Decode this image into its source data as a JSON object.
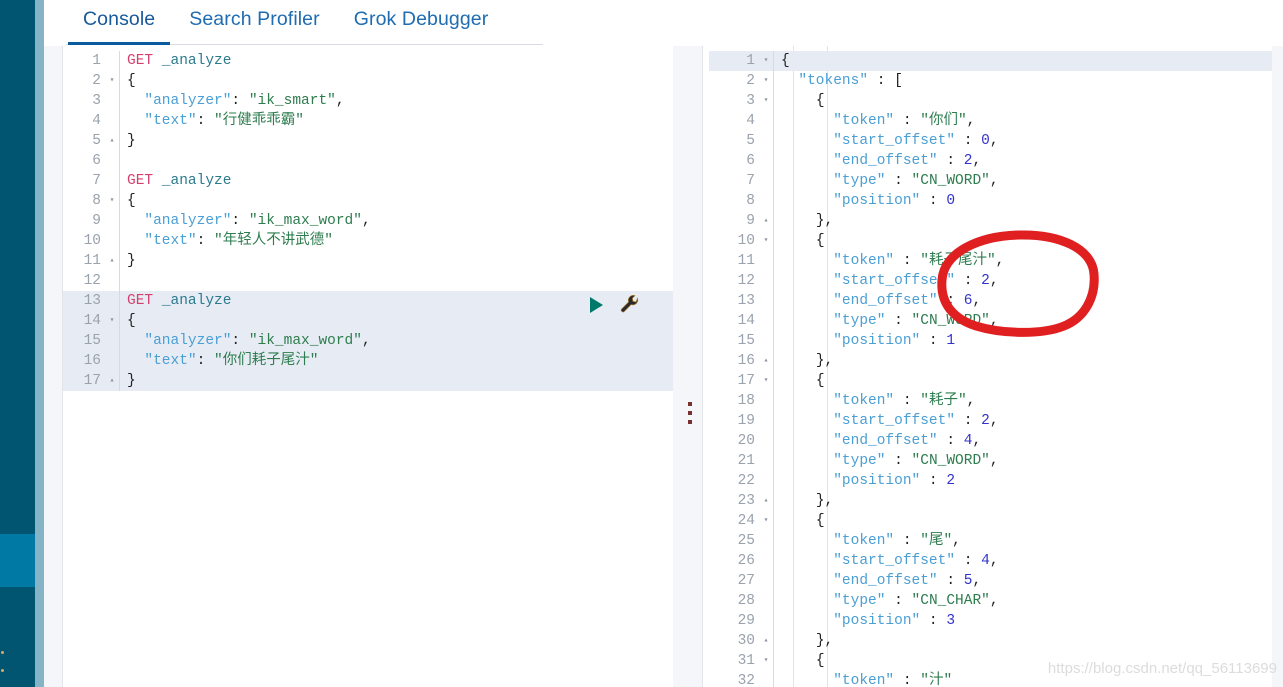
{
  "sidebar": {
    "truncated_labels": [
      "rning",
      "e"
    ],
    "bg_color": "#015571",
    "active_color": "#0079a5",
    "edge_color": "#84b4c6"
  },
  "tabs": [
    {
      "label": "Console",
      "active": true
    },
    {
      "label": "Search Profiler",
      "active": false
    },
    {
      "label": "Grok Debugger",
      "active": false
    }
  ],
  "left_editor": {
    "icons": {
      "run": "play-icon",
      "wrench": "wrench-icon"
    },
    "lines": [
      {
        "n": "1",
        "fold": "",
        "hl": false,
        "tokens": [
          [
            "t-method",
            "GET"
          ],
          [
            "t-punct",
            " "
          ],
          [
            "t-url",
            "_analyze"
          ]
        ]
      },
      {
        "n": "2",
        "fold": "▾",
        "hl": false,
        "tokens": [
          [
            "t-brace",
            "{"
          ]
        ]
      },
      {
        "n": "3",
        "fold": "",
        "hl": false,
        "tokens": [
          [
            "t-punct",
            "  "
          ],
          [
            "t-key",
            "\"analyzer\""
          ],
          [
            "t-punct",
            ": "
          ],
          [
            "t-str",
            "\"ik_smart\""
          ],
          [
            "t-punct",
            ","
          ]
        ]
      },
      {
        "n": "4",
        "fold": "",
        "hl": false,
        "tokens": [
          [
            "t-punct",
            "  "
          ],
          [
            "t-key",
            "\"text\""
          ],
          [
            "t-punct",
            ": "
          ],
          [
            "t-str",
            "\"行健乖乖霸\""
          ]
        ]
      },
      {
        "n": "5",
        "fold": "▴",
        "hl": false,
        "tokens": [
          [
            "t-brace",
            "}"
          ]
        ]
      },
      {
        "n": "6",
        "fold": "",
        "hl": false,
        "tokens": []
      },
      {
        "n": "7",
        "fold": "",
        "hl": false,
        "tokens": [
          [
            "t-method",
            "GET"
          ],
          [
            "t-punct",
            " "
          ],
          [
            "t-url",
            "_analyze"
          ]
        ]
      },
      {
        "n": "8",
        "fold": "▾",
        "hl": false,
        "tokens": [
          [
            "t-brace",
            "{"
          ]
        ]
      },
      {
        "n": "9",
        "fold": "",
        "hl": false,
        "tokens": [
          [
            "t-punct",
            "  "
          ],
          [
            "t-key",
            "\"analyzer\""
          ],
          [
            "t-punct",
            ": "
          ],
          [
            "t-str",
            "\"ik_max_word\""
          ],
          [
            "t-punct",
            ","
          ]
        ]
      },
      {
        "n": "10",
        "fold": "",
        "hl": false,
        "tokens": [
          [
            "t-punct",
            "  "
          ],
          [
            "t-key",
            "\"text\""
          ],
          [
            "t-punct",
            ": "
          ],
          [
            "t-str",
            "\"年轻人不讲武德\""
          ]
        ]
      },
      {
        "n": "11",
        "fold": "▴",
        "hl": false,
        "tokens": [
          [
            "t-brace",
            "}"
          ]
        ]
      },
      {
        "n": "12",
        "fold": "",
        "hl": false,
        "tokens": []
      },
      {
        "n": "13",
        "fold": "",
        "hl": true,
        "tokens": [
          [
            "t-method",
            "GET"
          ],
          [
            "t-punct",
            " "
          ],
          [
            "t-url",
            "_analyze"
          ]
        ]
      },
      {
        "n": "14",
        "fold": "▾",
        "hl": true,
        "tokens": [
          [
            "t-brace",
            "{"
          ]
        ]
      },
      {
        "n": "15",
        "fold": "",
        "hl": true,
        "tokens": [
          [
            "t-punct",
            "  "
          ],
          [
            "t-key",
            "\"analyzer\""
          ],
          [
            "t-punct",
            ": "
          ],
          [
            "t-str",
            "\"ik_max_word\""
          ],
          [
            "t-punct",
            ","
          ]
        ]
      },
      {
        "n": "16",
        "fold": "",
        "hl": true,
        "tokens": [
          [
            "t-punct",
            "  "
          ],
          [
            "t-key",
            "\"text\""
          ],
          [
            "t-punct",
            ": "
          ],
          [
            "t-str",
            "\"你们耗子尾汁\""
          ]
        ]
      },
      {
        "n": "17",
        "fold": "▴",
        "hl": true,
        "tokens": [
          [
            "t-brace",
            "}"
          ]
        ]
      }
    ]
  },
  "right_output": {
    "lines": [
      {
        "n": "1",
        "fold": "▾",
        "hl": true,
        "tokens": [
          [
            "t-brace",
            "{"
          ]
        ]
      },
      {
        "n": "2",
        "fold": "▾",
        "hl": false,
        "tokens": [
          [
            "t-punct",
            "  "
          ],
          [
            "t-key",
            "\"tokens\""
          ],
          [
            "t-punct",
            " : "
          ],
          [
            "t-brace",
            "["
          ]
        ]
      },
      {
        "n": "3",
        "fold": "▾",
        "hl": false,
        "tokens": [
          [
            "t-punct",
            "    "
          ],
          [
            "t-brace",
            "{"
          ]
        ]
      },
      {
        "n": "4",
        "fold": "",
        "hl": false,
        "tokens": [
          [
            "t-punct",
            "      "
          ],
          [
            "t-key",
            "\"token\""
          ],
          [
            "t-punct",
            " : "
          ],
          [
            "t-str",
            "\"你们\""
          ],
          [
            "t-punct",
            ","
          ]
        ]
      },
      {
        "n": "5",
        "fold": "",
        "hl": false,
        "tokens": [
          [
            "t-punct",
            "      "
          ],
          [
            "t-key",
            "\"start_offset\""
          ],
          [
            "t-punct",
            " : "
          ],
          [
            "t-num",
            "0"
          ],
          [
            "t-punct",
            ","
          ]
        ]
      },
      {
        "n": "6",
        "fold": "",
        "hl": false,
        "tokens": [
          [
            "t-punct",
            "      "
          ],
          [
            "t-key",
            "\"end_offset\""
          ],
          [
            "t-punct",
            " : "
          ],
          [
            "t-num",
            "2"
          ],
          [
            "t-punct",
            ","
          ]
        ]
      },
      {
        "n": "7",
        "fold": "",
        "hl": false,
        "tokens": [
          [
            "t-punct",
            "      "
          ],
          [
            "t-key",
            "\"type\""
          ],
          [
            "t-punct",
            " : "
          ],
          [
            "t-str",
            "\"CN_WORD\""
          ],
          [
            "t-punct",
            ","
          ]
        ]
      },
      {
        "n": "8",
        "fold": "",
        "hl": false,
        "tokens": [
          [
            "t-punct",
            "      "
          ],
          [
            "t-key",
            "\"position\""
          ],
          [
            "t-punct",
            " : "
          ],
          [
            "t-num",
            "0"
          ]
        ]
      },
      {
        "n": "9",
        "fold": "▴",
        "hl": false,
        "tokens": [
          [
            "t-punct",
            "    "
          ],
          [
            "t-brace",
            "}"
          ],
          [
            "t-punct",
            ","
          ]
        ]
      },
      {
        "n": "10",
        "fold": "▾",
        "hl": false,
        "tokens": [
          [
            "t-punct",
            "    "
          ],
          [
            "t-brace",
            "{"
          ]
        ]
      },
      {
        "n": "11",
        "fold": "",
        "hl": false,
        "tokens": [
          [
            "t-punct",
            "      "
          ],
          [
            "t-key",
            "\"token\""
          ],
          [
            "t-punct",
            " : "
          ],
          [
            "t-str",
            "\"耗子尾汁\""
          ],
          [
            "t-punct",
            ","
          ]
        ]
      },
      {
        "n": "12",
        "fold": "",
        "hl": false,
        "tokens": [
          [
            "t-punct",
            "      "
          ],
          [
            "t-key",
            "\"start_offset\""
          ],
          [
            "t-punct",
            " : "
          ],
          [
            "t-num",
            "2"
          ],
          [
            "t-punct",
            ","
          ]
        ]
      },
      {
        "n": "13",
        "fold": "",
        "hl": false,
        "tokens": [
          [
            "t-punct",
            "      "
          ],
          [
            "t-key",
            "\"end_offset\""
          ],
          [
            "t-punct",
            " : "
          ],
          [
            "t-num",
            "6"
          ],
          [
            "t-punct",
            ","
          ]
        ]
      },
      {
        "n": "14",
        "fold": "",
        "hl": false,
        "tokens": [
          [
            "t-punct",
            "      "
          ],
          [
            "t-key",
            "\"type\""
          ],
          [
            "t-punct",
            " : "
          ],
          [
            "t-str",
            "\"CN_WORD\""
          ],
          [
            "t-punct",
            ","
          ]
        ]
      },
      {
        "n": "15",
        "fold": "",
        "hl": false,
        "tokens": [
          [
            "t-punct",
            "      "
          ],
          [
            "t-key",
            "\"position\""
          ],
          [
            "t-punct",
            " : "
          ],
          [
            "t-num",
            "1"
          ]
        ]
      },
      {
        "n": "16",
        "fold": "▴",
        "hl": false,
        "tokens": [
          [
            "t-punct",
            "    "
          ],
          [
            "t-brace",
            "}"
          ],
          [
            "t-punct",
            ","
          ]
        ]
      },
      {
        "n": "17",
        "fold": "▾",
        "hl": false,
        "tokens": [
          [
            "t-punct",
            "    "
          ],
          [
            "t-brace",
            "{"
          ]
        ]
      },
      {
        "n": "18",
        "fold": "",
        "hl": false,
        "tokens": [
          [
            "t-punct",
            "      "
          ],
          [
            "t-key",
            "\"token\""
          ],
          [
            "t-punct",
            " : "
          ],
          [
            "t-str",
            "\"耗子\""
          ],
          [
            "t-punct",
            ","
          ]
        ]
      },
      {
        "n": "19",
        "fold": "",
        "hl": false,
        "tokens": [
          [
            "t-punct",
            "      "
          ],
          [
            "t-key",
            "\"start_offset\""
          ],
          [
            "t-punct",
            " : "
          ],
          [
            "t-num",
            "2"
          ],
          [
            "t-punct",
            ","
          ]
        ]
      },
      {
        "n": "20",
        "fold": "",
        "hl": false,
        "tokens": [
          [
            "t-punct",
            "      "
          ],
          [
            "t-key",
            "\"end_offset\""
          ],
          [
            "t-punct",
            " : "
          ],
          [
            "t-num",
            "4"
          ],
          [
            "t-punct",
            ","
          ]
        ]
      },
      {
        "n": "21",
        "fold": "",
        "hl": false,
        "tokens": [
          [
            "t-punct",
            "      "
          ],
          [
            "t-key",
            "\"type\""
          ],
          [
            "t-punct",
            " : "
          ],
          [
            "t-str",
            "\"CN_WORD\""
          ],
          [
            "t-punct",
            ","
          ]
        ]
      },
      {
        "n": "22",
        "fold": "",
        "hl": false,
        "tokens": [
          [
            "t-punct",
            "      "
          ],
          [
            "t-key",
            "\"position\""
          ],
          [
            "t-punct",
            " : "
          ],
          [
            "t-num",
            "2"
          ]
        ]
      },
      {
        "n": "23",
        "fold": "▴",
        "hl": false,
        "tokens": [
          [
            "t-punct",
            "    "
          ],
          [
            "t-brace",
            "}"
          ],
          [
            "t-punct",
            ","
          ]
        ]
      },
      {
        "n": "24",
        "fold": "▾",
        "hl": false,
        "tokens": [
          [
            "t-punct",
            "    "
          ],
          [
            "t-brace",
            "{"
          ]
        ]
      },
      {
        "n": "25",
        "fold": "",
        "hl": false,
        "tokens": [
          [
            "t-punct",
            "      "
          ],
          [
            "t-key",
            "\"token\""
          ],
          [
            "t-punct",
            " : "
          ],
          [
            "t-str",
            "\"尾\""
          ],
          [
            "t-punct",
            ","
          ]
        ]
      },
      {
        "n": "26",
        "fold": "",
        "hl": false,
        "tokens": [
          [
            "t-punct",
            "      "
          ],
          [
            "t-key",
            "\"start_offset\""
          ],
          [
            "t-punct",
            " : "
          ],
          [
            "t-num",
            "4"
          ],
          [
            "t-punct",
            ","
          ]
        ]
      },
      {
        "n": "27",
        "fold": "",
        "hl": false,
        "tokens": [
          [
            "t-punct",
            "      "
          ],
          [
            "t-key",
            "\"end_offset\""
          ],
          [
            "t-punct",
            " : "
          ],
          [
            "t-num",
            "5"
          ],
          [
            "t-punct",
            ","
          ]
        ]
      },
      {
        "n": "28",
        "fold": "",
        "hl": false,
        "tokens": [
          [
            "t-punct",
            "      "
          ],
          [
            "t-key",
            "\"type\""
          ],
          [
            "t-punct",
            " : "
          ],
          [
            "t-str",
            "\"CN_CHAR\""
          ],
          [
            "t-punct",
            ","
          ]
        ]
      },
      {
        "n": "29",
        "fold": "",
        "hl": false,
        "tokens": [
          [
            "t-punct",
            "      "
          ],
          [
            "t-key",
            "\"position\""
          ],
          [
            "t-punct",
            " : "
          ],
          [
            "t-num",
            "3"
          ]
        ]
      },
      {
        "n": "30",
        "fold": "▴",
        "hl": false,
        "tokens": [
          [
            "t-punct",
            "    "
          ],
          [
            "t-brace",
            "}"
          ],
          [
            "t-punct",
            ","
          ]
        ]
      },
      {
        "n": "31",
        "fold": "▾",
        "hl": false,
        "tokens": [
          [
            "t-punct",
            "    "
          ],
          [
            "t-brace",
            "{"
          ]
        ]
      },
      {
        "n": "32",
        "fold": "",
        "hl": false,
        "tokens": [
          [
            "t-punct",
            "      "
          ],
          [
            "t-key",
            "\"token\""
          ],
          [
            "t-punct",
            " : "
          ],
          [
            "t-str",
            "\"汁\""
          ]
        ]
      }
    ]
  },
  "annotation": {
    "type": "hand-drawn-red-circle",
    "color": "#e02020",
    "encircles": "耗子尾汁 token value"
  },
  "watermark": {
    "text": "https://blog.csdn.net/qq_56113699"
  }
}
